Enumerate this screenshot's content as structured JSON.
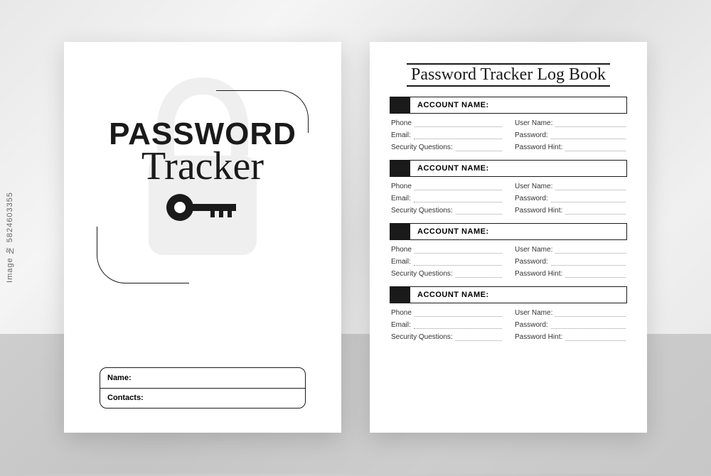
{
  "watermark": "Image № 5824603355",
  "cover": {
    "title_main": "PASSWORD",
    "title_sub": "Tracker",
    "owner_name_label": "Name:",
    "owner_contacts_label": "Contacts:"
  },
  "log": {
    "page_title": "Password Tracker Log Book",
    "entries": [
      {
        "heading": "ACCOUNT NAME:",
        "left": [
          "Phone",
          "Email:",
          "Security Questions:"
        ],
        "right": [
          "User Name:",
          "Password:",
          "Password Hint:"
        ]
      },
      {
        "heading": "ACCOUNT NAME:",
        "left": [
          "Phone",
          "Email:",
          "Security Questions:"
        ],
        "right": [
          "User Name:",
          "Password:",
          "Password Hint:"
        ]
      },
      {
        "heading": "ACCOUNT NAME:",
        "left": [
          "Phone",
          "Email:",
          "Security Questions:"
        ],
        "right": [
          "User Name:",
          "Password:",
          "Password Hint:"
        ]
      },
      {
        "heading": "ACCOUNT NAME:",
        "left": [
          "Phone",
          "Email:",
          "Security Questions:"
        ],
        "right": [
          "User Name:",
          "Password:",
          "Password Hint:"
        ]
      }
    ]
  }
}
